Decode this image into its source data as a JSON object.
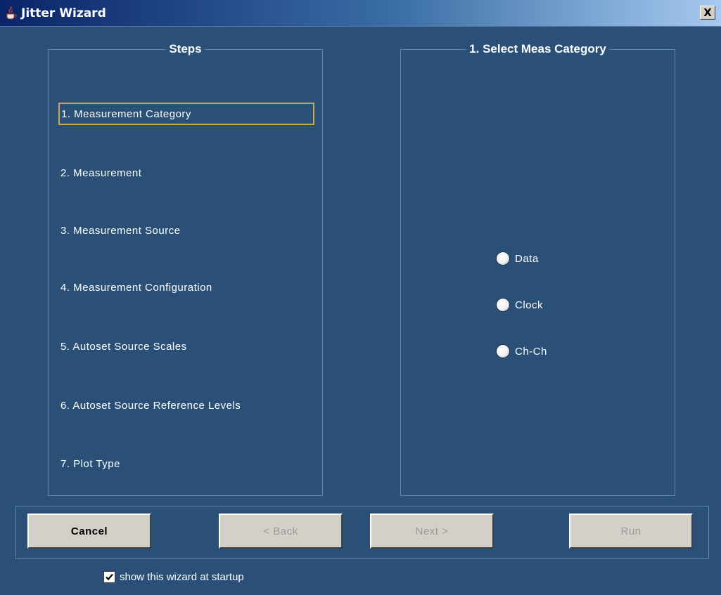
{
  "window": {
    "title": "Jitter Wizard",
    "close_label": "X"
  },
  "steps_panel": {
    "title": "Steps",
    "items": [
      {
        "label": "1. Measurement Category",
        "selected": true
      },
      {
        "label": "2. Measurement",
        "selected": false
      },
      {
        "label": "3. Measurement Source",
        "selected": false
      },
      {
        "label": "4. Measurement Configuration",
        "selected": false
      },
      {
        "label": "5. Autoset Source Scales",
        "selected": false
      },
      {
        "label": "6. Autoset Source Reference Levels",
        "selected": false
      },
      {
        "label": "7. Plot Type",
        "selected": false
      }
    ]
  },
  "category_panel": {
    "title": "1. Select Meas Category",
    "options": [
      {
        "label": "Data",
        "checked": false
      },
      {
        "label": "Clock",
        "checked": false
      },
      {
        "label": "Ch-Ch",
        "checked": false
      }
    ]
  },
  "buttons": {
    "cancel": "Cancel",
    "back": "< Back",
    "next": "Next >",
    "run": "Run"
  },
  "startup_checkbox": {
    "label": "show this wizard at startup",
    "checked": true
  },
  "colors": {
    "background": "#2a5078",
    "selection_border": "#c9a640",
    "group_border": "#5c88b4"
  }
}
